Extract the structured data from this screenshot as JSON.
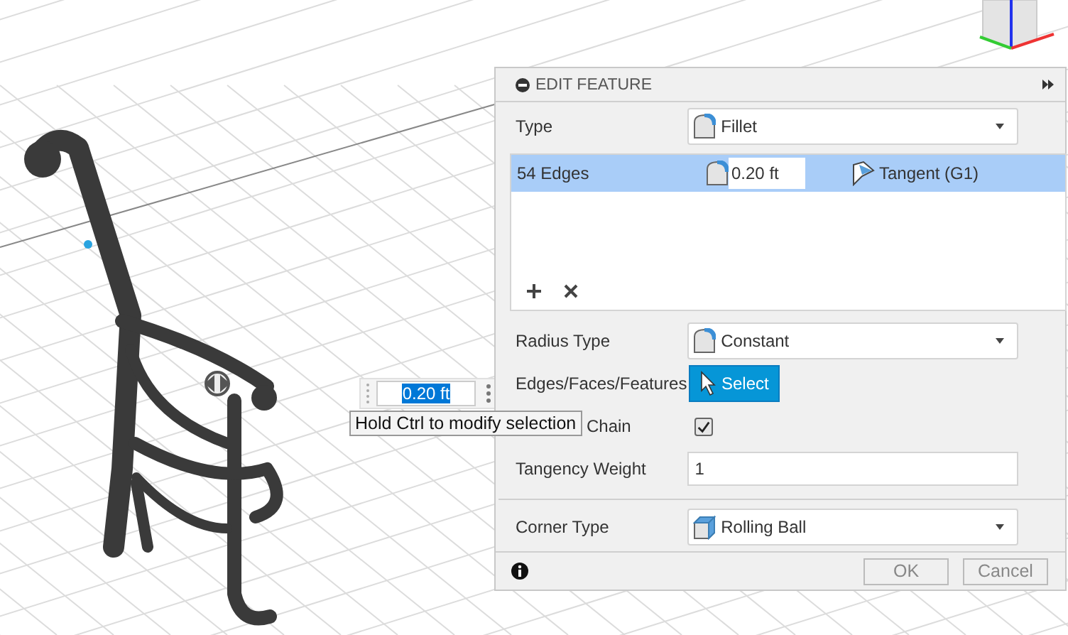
{
  "viewport": {
    "dimension_input": {
      "value": "0.20 ft",
      "selected": true
    },
    "tooltip": "Hold Ctrl to modify selection"
  },
  "dialog": {
    "title": "EDIT FEATURE",
    "rows": [
      {
        "kind": "dropdown",
        "label": "Type",
        "value": "Fillet"
      },
      {
        "kind": "list",
        "items": [
          {
            "label": "54 Edges",
            "radius": "0.20 ft",
            "continuity": "Tangent (G1)",
            "selected": true
          }
        ]
      },
      {
        "kind": "dropdown",
        "label": "Radius Type",
        "value": "Constant"
      },
      {
        "kind": "button",
        "label": "Edges/Faces/Features",
        "value": "Select"
      },
      {
        "kind": "checkbox",
        "label": "Chain",
        "checked": true
      },
      {
        "kind": "text",
        "label": "Tangency Weight",
        "value": "1"
      },
      {
        "kind": "dropdown",
        "label": "Corner Type",
        "value": "Rolling Ball",
        "separated": true
      }
    ],
    "buttons": [
      "OK",
      "Cancel"
    ]
  }
}
